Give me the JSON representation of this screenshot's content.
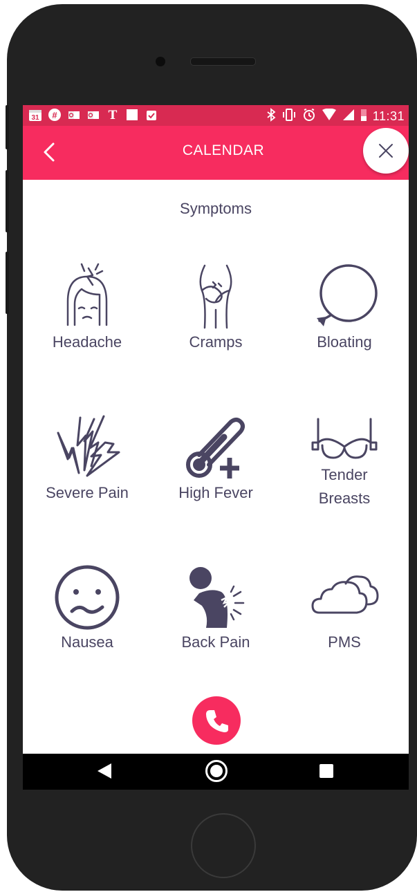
{
  "status_bar": {
    "time": "11:31",
    "calendar_day": "31",
    "icons_left": [
      "calendar-icon",
      "slack-icon",
      "outlook-icon",
      "outlook-icon",
      "nytimes-icon",
      "square-icon",
      "clipboard-icon"
    ],
    "icons_right": [
      "bluetooth-icon",
      "vibrate-icon",
      "alarm-icon",
      "wifi-icon",
      "signal-icon",
      "battery-icon"
    ]
  },
  "app_bar": {
    "title": "CALENDAR"
  },
  "section": {
    "heading": "Symptoms"
  },
  "symptoms": [
    {
      "label": "Headache",
      "icon": "headache-icon"
    },
    {
      "label": "Cramps",
      "icon": "cramps-icon"
    },
    {
      "label": "Bloating",
      "icon": "balloon-icon"
    },
    {
      "label": "Severe Pain",
      "icon": "lightning-icon"
    },
    {
      "label": "High Fever",
      "icon": "thermometer-icon"
    },
    {
      "label": "Tender Breasts",
      "icon": "bra-icon"
    },
    {
      "label": "Nausea",
      "icon": "nausea-face-icon"
    },
    {
      "label": "Back Pain",
      "icon": "back-pain-icon"
    },
    {
      "label": "PMS",
      "icon": "cloud-icon"
    }
  ],
  "colors": {
    "accent": "#f72c5f",
    "status_bar": "#d82a52",
    "icon_color": "#4a4562"
  }
}
